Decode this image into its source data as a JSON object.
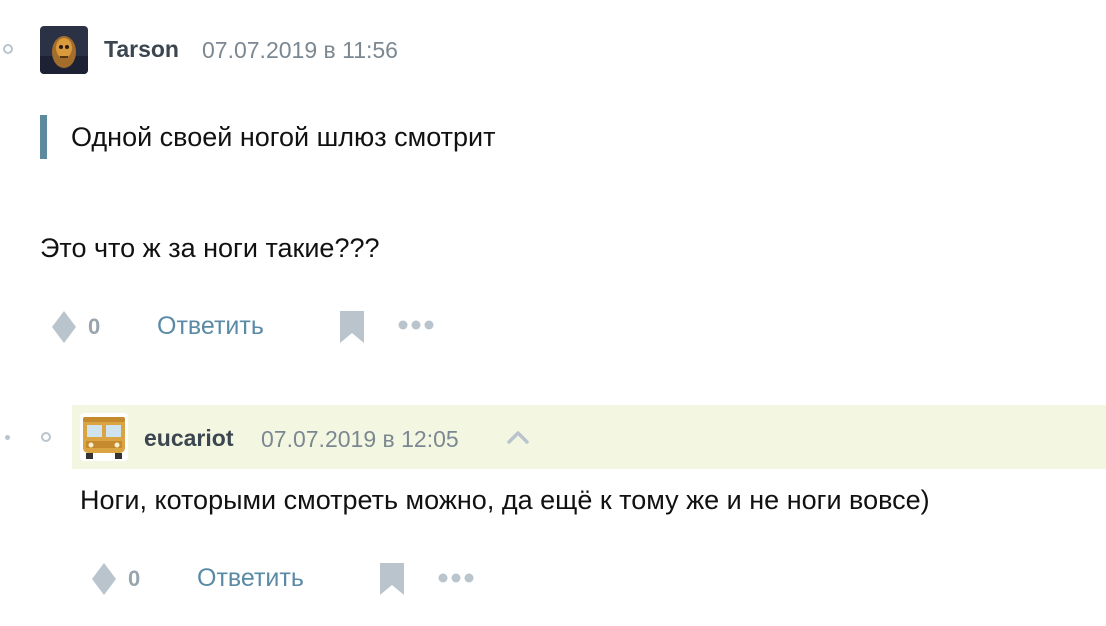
{
  "comments": [
    {
      "author": "Tarson",
      "time": "07.07.2019 в 11:56",
      "quote": "Одной своей ногой шлюз смотрит",
      "text": "Это что ж за ноги такие???",
      "votes": "0",
      "reply_label": "Ответить"
    },
    {
      "author": "eucariot",
      "time": "07.07.2019 в 12:05",
      "text": "Ноги, которыми смотреть можно, да ещё к тому же и не ноги вовсе)",
      "votes": "0",
      "reply_label": "Ответить"
    }
  ],
  "icons": {
    "vote": "rhombus-icon",
    "bookmark": "bookmark-icon",
    "more": "more-dots-icon",
    "parent": "chevron-up-icon"
  },
  "colors": {
    "link": "#5a8aa6",
    "quote_bar": "#5e8a9d",
    "icon": "#b9c4cc",
    "new_comment_bg": "#f3f7e2"
  }
}
